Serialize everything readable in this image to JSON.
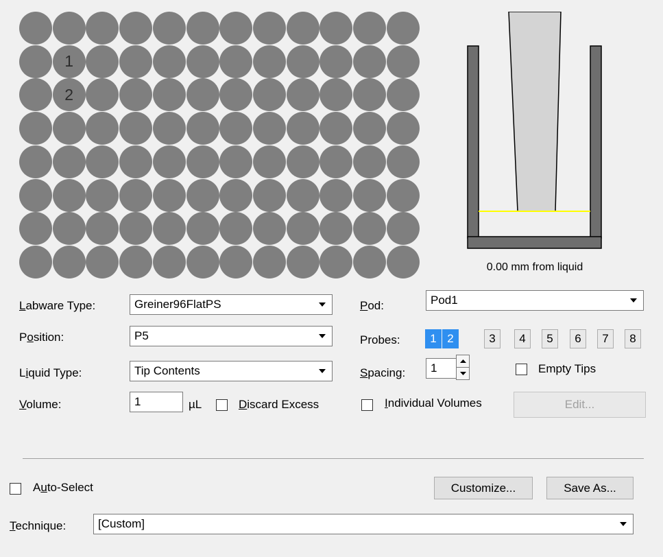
{
  "plate": {
    "rows": 8,
    "cols": 12,
    "labeled_wells": [
      {
        "row": 1,
        "col": 1,
        "label": "1"
      },
      {
        "row": 2,
        "col": 1,
        "label": "2"
      }
    ],
    "well_color": "#7f7f7f"
  },
  "tip_diagram": {
    "caption": "0.00 mm from liquid",
    "liquid_line_color": "#ffff00"
  },
  "form": {
    "labware_type": {
      "label_u": "L",
      "label_rest": "abware Type:",
      "value": "Greiner96FlatPS"
    },
    "position": {
      "label_pre": "P",
      "label_u": "o",
      "label_rest": "sition:",
      "value": "P5"
    },
    "liquid_type": {
      "label_pre": "L",
      "label_u": "i",
      "label_rest": "quid Type:",
      "value": "Tip Contents"
    },
    "volume": {
      "label_u": "V",
      "label_rest": "olume:",
      "value": "1",
      "unit": "µL"
    },
    "discard_excess": {
      "label_u": "D",
      "label_rest": "iscard Excess",
      "checked": false
    },
    "pod": {
      "label_u": "P",
      "label_rest": "od:",
      "value": "Pod1"
    },
    "probes": {
      "label": "Probes:",
      "items": [
        {
          "label": "1",
          "selected": true
        },
        {
          "label": "2",
          "selected": true
        },
        {
          "label": "3",
          "selected": false
        },
        {
          "label": "4",
          "selected": false
        },
        {
          "label": "5",
          "selected": false
        },
        {
          "label": "6",
          "selected": false
        },
        {
          "label": "7",
          "selected": false
        },
        {
          "label": "8",
          "selected": false
        }
      ]
    },
    "spacing": {
      "label_u": "S",
      "label_rest": "pacing:",
      "value": "1"
    },
    "empty_tips": {
      "label": "Empty Tips",
      "checked": false
    },
    "individual_volumes": {
      "label_u": "I",
      "label_rest": "ndividual Volumes",
      "checked": false
    },
    "edit_button": "Edit..."
  },
  "bottom": {
    "auto_select": {
      "label_pre": "A",
      "label_u": "u",
      "label_rest": "to-Select",
      "checked": false
    },
    "customize_button": "Customize...",
    "save_as_button": "Save As...",
    "technique": {
      "label_u": "T",
      "label_rest": "echnique:",
      "value": "[Custom]"
    }
  },
  "colors": {
    "selected_probe": "#2f8ff0",
    "background": "#f0f0f0"
  }
}
